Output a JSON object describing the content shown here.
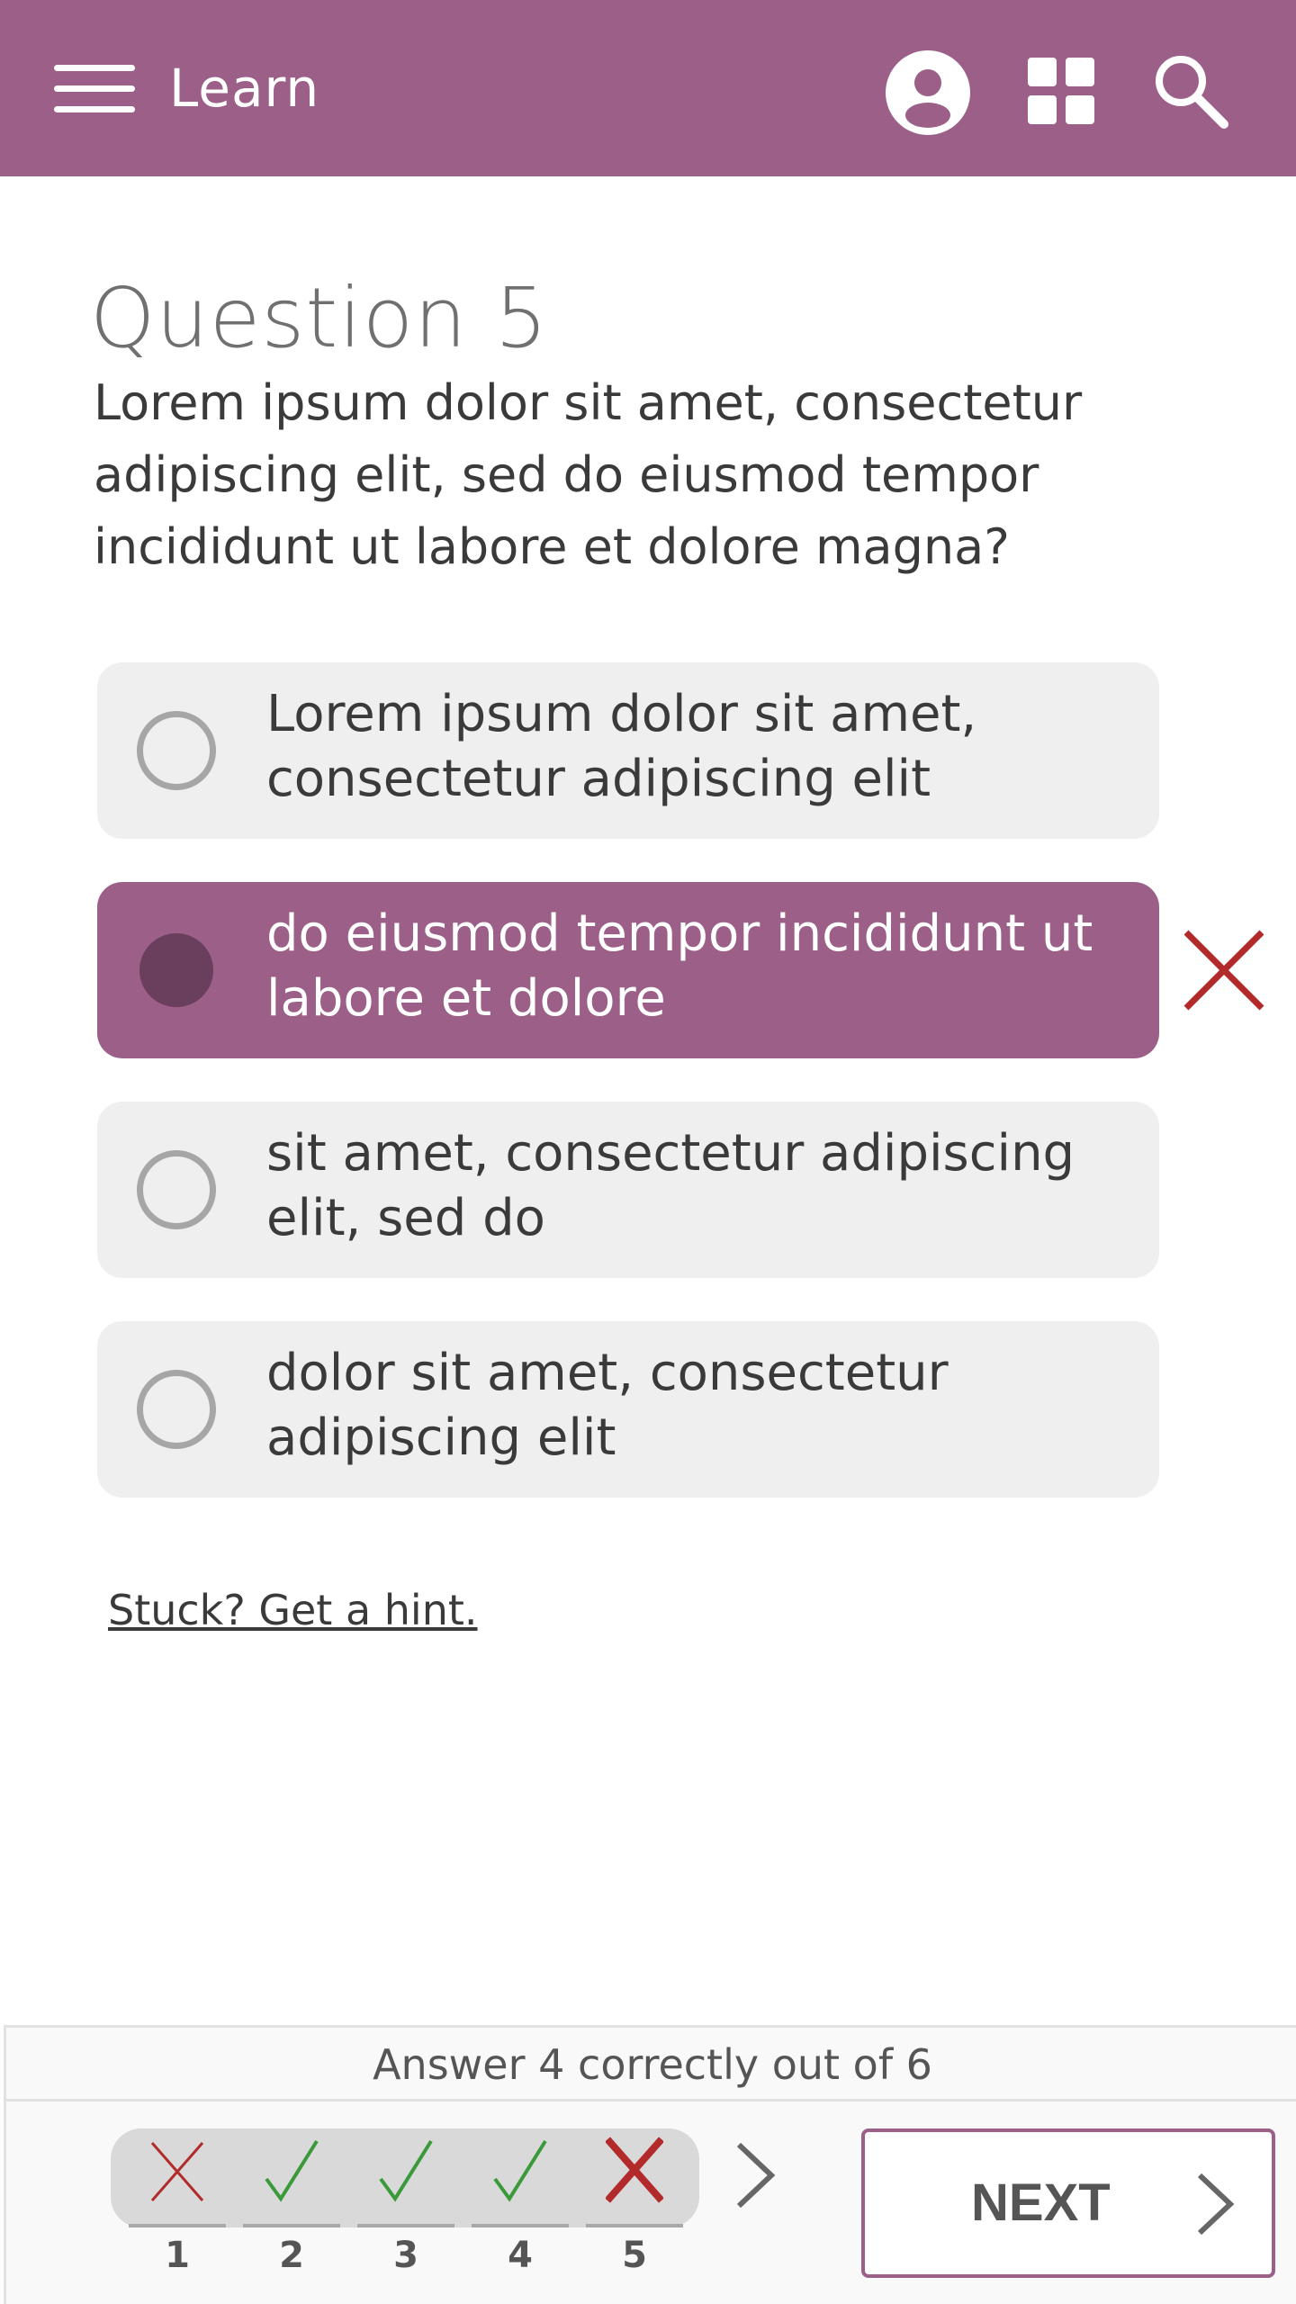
{
  "header": {
    "title": "Learn",
    "background_color": "#9b5f88",
    "icons": [
      "menu-icon",
      "user-icon",
      "grid-icon",
      "search-icon"
    ]
  },
  "question": {
    "title": "Question 5",
    "text": "Lorem ipsum dolor sit amet, consectetur adipiscing elit, sed do eiusmod tempor incididunt ut labore et dolore magna?"
  },
  "answers": [
    {
      "label": "Lorem ipsum dolor sit amet, consectetur adipiscing elit",
      "selected": false
    },
    {
      "label": "do eiusmod tempor incididunt ut labore et dolore",
      "selected": true,
      "result": "incorrect"
    },
    {
      "label": "sit amet, consectetur adipiscing elit, sed do",
      "selected": false
    },
    {
      "label": "dolor sit amet, consectetur adipiscing elit",
      "selected": false
    }
  ],
  "hint_link": "Stuck? Get a hint.",
  "progress": {
    "caption": "Answer 4 correctly out of 6",
    "items": [
      {
        "number": "1",
        "result": "incorrect"
      },
      {
        "number": "2",
        "result": "correct"
      },
      {
        "number": "3",
        "result": "correct"
      },
      {
        "number": "4",
        "result": "correct"
      },
      {
        "number": "5",
        "result": "incorrect",
        "current": true
      }
    ]
  },
  "next_button": {
    "label": "NEXT"
  },
  "colors": {
    "accent": "#9b5f88",
    "selected_radio": "#6a3f5e",
    "correct": "#3a9a3a",
    "incorrect": "#b22a2a"
  }
}
